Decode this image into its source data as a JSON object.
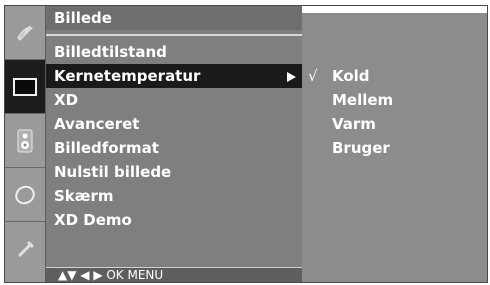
{
  "menu": {
    "title": "Billede",
    "items": [
      {
        "label": "Billedtilstand",
        "selected": false
      },
      {
        "label": "Kernetemperatur",
        "selected": true
      },
      {
        "label": "XD",
        "selected": false
      },
      {
        "label": "Avanceret",
        "selected": false
      },
      {
        "label": "Billedformat",
        "selected": false
      },
      {
        "label": "Nulstil billede",
        "selected": false
      },
      {
        "label": "Skærm",
        "selected": false
      },
      {
        "label": "XD Demo",
        "selected": false
      }
    ],
    "footer": "▲▼  ◀ ▶  OK  MENU"
  },
  "submenu": {
    "check_mark": "√",
    "items": [
      {
        "label": "Kold",
        "checked": true
      },
      {
        "label": "Mellem",
        "checked": false
      },
      {
        "label": "Varm",
        "checked": false
      },
      {
        "label": "Bruger",
        "checked": false
      }
    ]
  },
  "sidebar": {
    "icons": [
      "satellite-dish-icon",
      "picture-screen-icon",
      "speaker-icon",
      "clock-icon",
      "option-icon"
    ]
  },
  "colors": {
    "panel": "#7f7f7f",
    "highlight": "#1a1a1a",
    "text": "#ffffff"
  }
}
